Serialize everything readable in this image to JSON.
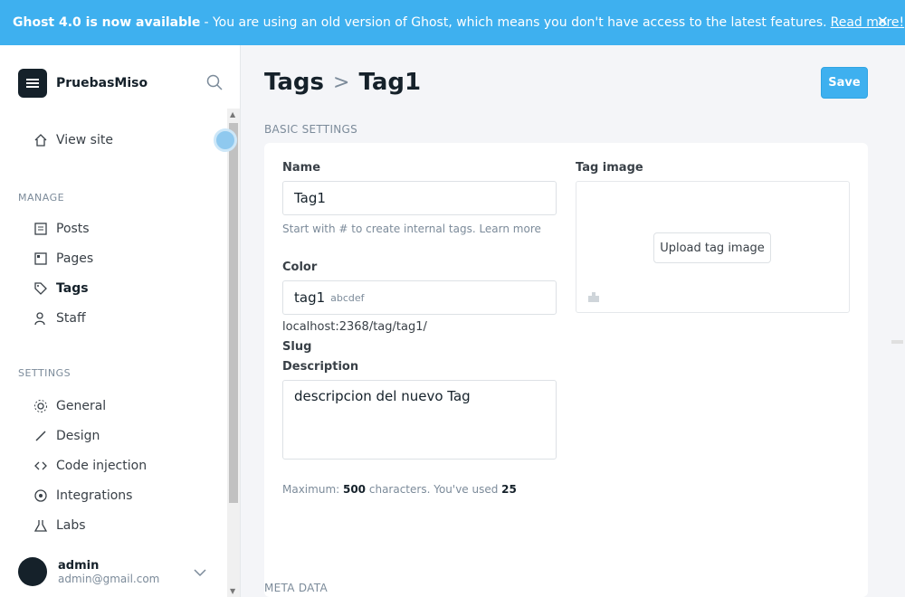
{
  "banner": {
    "title": "Ghost 4.0 is now available",
    "message": "- You are using an old version of Ghost, which means you don't have access to the latest features.",
    "link": "Read more!"
  },
  "sidebar": {
    "site_name": "PruebasMiso",
    "view_site": "View site",
    "manage_label": "MANAGE",
    "manage_items": [
      {
        "label": "Posts",
        "icon": "posts-icon"
      },
      {
        "label": "Pages",
        "icon": "pages-icon"
      },
      {
        "label": "Tags",
        "icon": "tags-icon"
      },
      {
        "label": "Staff",
        "icon": "staff-icon"
      }
    ],
    "settings_label": "SETTINGS",
    "settings_items": [
      {
        "label": "General",
        "icon": "gear-icon"
      },
      {
        "label": "Design",
        "icon": "brush-icon"
      },
      {
        "label": "Code injection",
        "icon": "code-icon"
      },
      {
        "label": "Integrations",
        "icon": "integrations-icon"
      },
      {
        "label": "Labs",
        "icon": "labs-icon"
      }
    ],
    "user": {
      "name": "admin",
      "email": "admin@gmail.com"
    }
  },
  "main": {
    "breadcrumb_parent": "Tags",
    "breadcrumb_current": "Tag1",
    "save_label": "Save",
    "section_title": "BASIC SETTINGS",
    "name_label": "Name",
    "name_value": "Tag1",
    "name_hint": "Start with # to create internal tags. Learn more",
    "color_label": "Color",
    "slug_value": "tag1",
    "slug_url": "localhost:2368/tag/tag1/",
    "slug_label": "Slug",
    "color_placeholder": "abcdef",
    "description_label": "Description",
    "description_value": "descripcion del nuevo Tag",
    "description_hint_prefix": "Maximum: ",
    "description_max": "500",
    "description_hint_mid": " characters. You've used ",
    "description_used": "25",
    "tag_image_label": "Tag image",
    "upload_label": "Upload tag image",
    "meta_title": "META DATA"
  }
}
